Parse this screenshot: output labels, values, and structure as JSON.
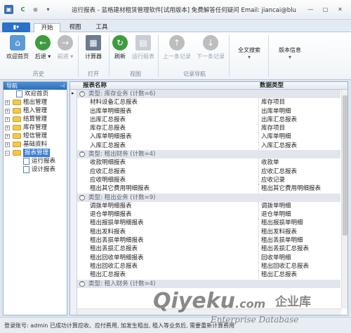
{
  "window": {
    "title": "运行报表 - 蓝格建材租赁管理软件[试用版本] 免费解答任何疑问 Email: jiancai@bluegrid....",
    "quick_access": [
      "C",
      "●",
      "▾"
    ],
    "controls": [
      "—",
      "▢",
      "✕"
    ]
  },
  "ribbon_tabs": {
    "file_label": "▮▾",
    "tabs": [
      "开始",
      "视图",
      "工具"
    ]
  },
  "ribbon": {
    "buttons": {
      "home": "欢迎首页",
      "back": "后退",
      "forward": "前进",
      "calculator": "计算器",
      "refresh": "刷新",
      "run_report": "运行报表",
      "prev_record": "上一条记录",
      "next_record": "下一条记录",
      "fulltext_search": "全文搜索",
      "version_info": "版本信息"
    },
    "groups": [
      "历史",
      "打开",
      "视图",
      "记录导航"
    ]
  },
  "nav": {
    "header": "导航",
    "pin": "⊣",
    "tree": [
      {
        "label": "欢迎首页",
        "type": "doc"
      },
      {
        "label": "租出管理",
        "type": "folder"
      },
      {
        "label": "租入管理",
        "type": "folder"
      },
      {
        "label": "结算管理",
        "type": "folder"
      },
      {
        "label": "库存管理",
        "type": "folder"
      },
      {
        "label": "短信管理",
        "type": "folder"
      },
      {
        "label": "基础资料",
        "type": "folder"
      },
      {
        "label": "报表管理",
        "type": "folder",
        "selected": true
      },
      {
        "label": "运行报表",
        "type": "child"
      },
      {
        "label": "设计报表",
        "type": "child"
      }
    ]
  },
  "grid": {
    "columns": [
      "报表名称",
      "数据类型"
    ],
    "row_marker": "▸",
    "groups": [
      {
        "label": "类型: 库存业务 (计数=6)",
        "rows": [
          [
            "材料设备汇总报表",
            "库存项目"
          ],
          [
            "出库单明细报表",
            "出库单明细"
          ],
          [
            "出库汇总报表",
            "出库汇总报表"
          ],
          [
            "库存汇总报表",
            "库存项目"
          ],
          [
            "入库单明细报表",
            "入库单明细"
          ],
          [
            "入库汇总报表",
            "入库汇总报表"
          ]
        ]
      },
      {
        "label": "类型: 租出财务 (计数=4)",
        "rows": [
          [
            "收款明细报表",
            "收款单"
          ],
          [
            "应收汇总报表",
            "应收汇总报表"
          ],
          [
            "应收明细报表",
            "应收记录"
          ],
          [
            "租出其它费用明细报表",
            "租出其它费用明细报表"
          ]
        ]
      },
      {
        "label": "类型: 租出业务 (计数=9)",
        "rows": [
          [
            "调拨单明细报表",
            "调拨单明细"
          ],
          [
            "退仓单明细报表",
            "退仓单明细"
          ],
          [
            "租出报损单明细报表",
            "租出报损单明细"
          ],
          [
            "租出发料报表",
            "租出发料报表"
          ],
          [
            "租出丢损单明细报表",
            "租出丢损单明细"
          ],
          [
            "租出丢损汇总报表",
            "租出丢损汇总报表"
          ],
          [
            "租出回收单明细报表",
            "回收单明细"
          ],
          [
            "租出回收汇总报表",
            "租出回收汇总报表"
          ],
          [
            "租出汇总报表",
            "租出汇总报表"
          ]
        ]
      },
      {
        "label": "类型: 租入财务 (计数=4)",
        "rows": []
      }
    ]
  },
  "status": {
    "text": "登录账号: admin   已成功计算应收、应付费用, 加发生租出, 租入等业务后, 需要重新计算费用"
  },
  "watermark": {
    "brand": "Qiyeku",
    "suffix": ".com",
    "cn": "企业库",
    "en": "Enterprise Database"
  },
  "colors": {
    "accent": "#2a72c8",
    "nav_header": "#3a7bd5",
    "group_row": "#e2e6ec",
    "folder": "#f2c84b"
  }
}
